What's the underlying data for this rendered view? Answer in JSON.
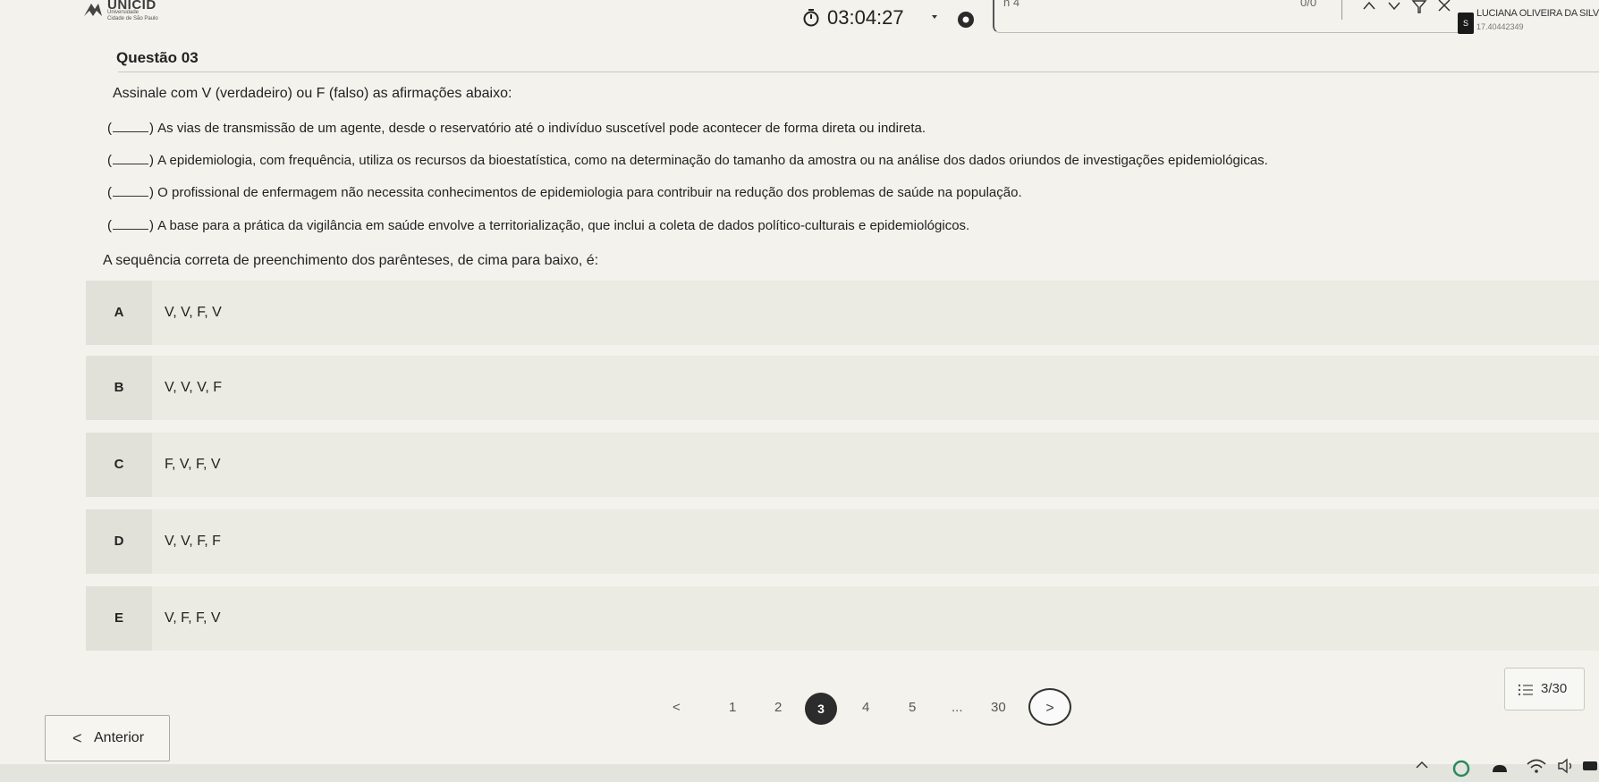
{
  "header": {
    "logo": {
      "name": "UNICID",
      "sub1": "Universidade",
      "sub2": "Cidade de São Paulo"
    },
    "timer": {
      "value": "03:04:27",
      "icon": "stopwatch-icon"
    },
    "find": {
      "query": "n 4",
      "count": "0/0"
    },
    "user": {
      "initial": "S",
      "name": "LUCIANA OLIVEIRA DA SILV",
      "id": "17.40442349"
    }
  },
  "question": {
    "title": "Questão 03",
    "prompt": "Assinale com V (verdadeiro) ou F (falso) as afirmações abaixo:",
    "statements": [
      {
        "open": "(",
        "close": ")",
        "text": "As vias de transmissão de um agente, desde o reservatório até o indivíduo suscetível pode acontecer de forma direta ou indireta."
      },
      {
        "open": "(",
        "close": ")",
        "text": "A epidemiologia, com frequência, utiliza os recursos da bioestatística, como na determinação do tamanho da amostra ou na análise dos dados oriundos de investigações epidemiológicas."
      },
      {
        "open": "(",
        "close": ")",
        "text": "O profissional de enfermagem não necessita conhecimentos de epidemiologia para contribuir na redução dos problemas de saúde na população."
      },
      {
        "open": "(",
        "close": ")",
        "text": "A base para a prática da vigilância em saúde envolve a territorialização, que inclui a coleta de dados político-culturais e epidemiológicos."
      }
    ],
    "sequence_prompt": "A sequência correta de preenchimento dos parênteses, de cima para baixo, é:"
  },
  "options": [
    {
      "letter": "A",
      "text": "V, V, F, V"
    },
    {
      "letter": "B",
      "text": "V, V, V, F"
    },
    {
      "letter": "C",
      "text": "F, V, F, V"
    },
    {
      "letter": "D",
      "text": "V, V, F, F"
    },
    {
      "letter": "E",
      "text": "V, F, F, V"
    }
  ],
  "pagination": {
    "prev": "<",
    "pages": [
      "1",
      "2",
      "3",
      "4",
      "5",
      "...",
      "30"
    ],
    "current": "3",
    "next": ">",
    "progress": "3/30"
  },
  "nav": {
    "previous_label": "Anterior",
    "previous_icon": "<"
  },
  "colors": {
    "active_page": "#2c2c2c",
    "option_bg": "#ebeae3",
    "page_bg": "#f3f2ec"
  }
}
